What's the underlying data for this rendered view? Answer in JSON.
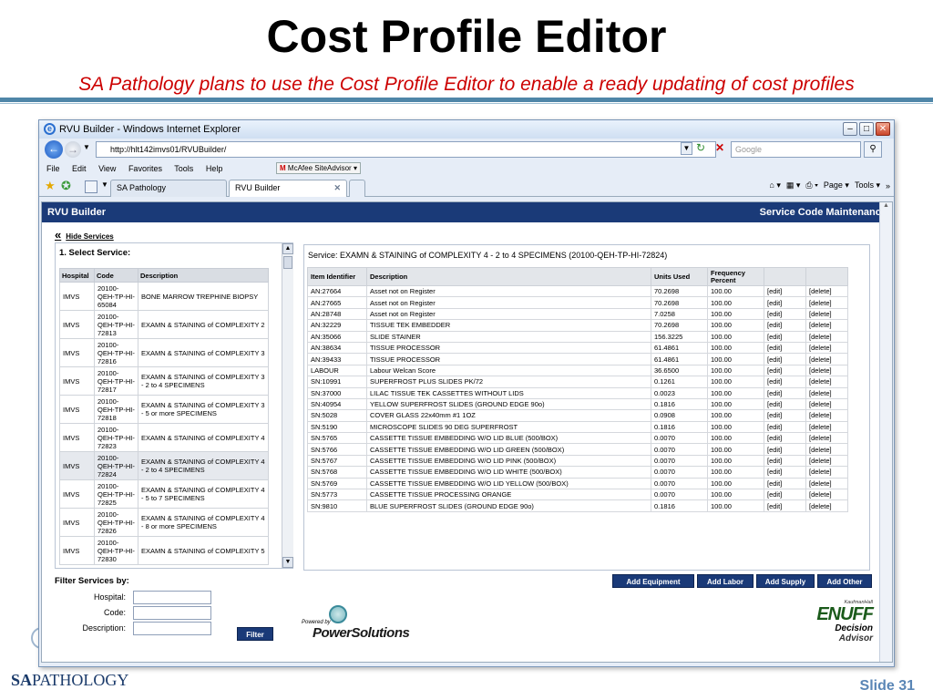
{
  "slide": {
    "title": "Cost Profile Editor",
    "subtitle": "SA Pathology plans to use the Cost Profile Editor to enable a ready updating of cost profiles",
    "footer_logo_left": "SA",
    "footer_logo_right": "PATHOLOGY",
    "slide_number": "Slide 31"
  },
  "browser": {
    "window_title": "RVU Builder - Windows Internet Explorer",
    "url": "http://hlt142imvs01/RVUBuilder/",
    "search_placeholder": "Google",
    "menu": [
      "File",
      "Edit",
      "View",
      "Favorites",
      "Tools",
      "Help"
    ],
    "mcafee": "McAfee SiteAdvisor",
    "tabs": [
      {
        "label": "SA Pathology",
        "active": false
      },
      {
        "label": "RVU Builder",
        "active": true
      }
    ],
    "toolbar_right": {
      "page": "Page",
      "tools": "Tools"
    }
  },
  "app": {
    "header_left": "RVU Builder",
    "header_right": "Service Code Maintenance",
    "hide_services": "Hide Services",
    "select_service_title": "1. Select Service:",
    "service_columns": [
      "Hospital",
      "Code",
      "Description"
    ],
    "services": [
      {
        "hospital": "IMVS",
        "code": "20100-QEH-TP-HI-65084",
        "description": "BONE MARROW TREPHINE BIOPSY",
        "selected": false
      },
      {
        "hospital": "IMVS",
        "code": "20100-QEH-TP-HI-72813",
        "description": "EXAMN & STAINING of COMPLEXITY 2",
        "selected": false
      },
      {
        "hospital": "IMVS",
        "code": "20100-QEH-TP-HI-72816",
        "description": "EXAMN & STAINING of COMPLEXITY 3",
        "selected": false
      },
      {
        "hospital": "IMVS",
        "code": "20100-QEH-TP-HI-72817",
        "description": "EXAMN & STAINING of COMPLEXITY 3 - 2 to 4 SPECIMENS",
        "selected": false
      },
      {
        "hospital": "IMVS",
        "code": "20100-QEH-TP-HI-72818",
        "description": "EXAMN & STAINING of COMPLEXITY 3 - 5 or more SPECIMENS",
        "selected": false
      },
      {
        "hospital": "IMVS",
        "code": "20100-QEH-TP-HI-72823",
        "description": "EXAMN & STAINING of COMPLEXITY 4",
        "selected": false
      },
      {
        "hospital": "IMVS",
        "code": "20100-QEH-TP-HI-72824",
        "description": "EXAMN & STAINING of COMPLEXITY 4 - 2 to 4 SPECIMENS",
        "selected": true
      },
      {
        "hospital": "IMVS",
        "code": "20100-QEH-TP-HI-72825",
        "description": "EXAMN & STAINING of COMPLEXITY 4 - 5 to 7 SPECIMENS",
        "selected": false
      },
      {
        "hospital": "IMVS",
        "code": "20100-QEH-TP-HI-72826",
        "description": "EXAMN & STAINING of COMPLEXITY 4 - 8 or more SPECIMENS",
        "selected": false
      },
      {
        "hospital": "IMVS",
        "code": "20100-QEH-TP-HI-72830",
        "description": "EXAMN & STAINING of COMPLEXITY 5",
        "selected": false
      }
    ],
    "service_title": "Service: EXAMN & STAINING of COMPLEXITY 4 - 2 to 4 SPECIMENS (20100-QEH-TP-HI-72824)",
    "item_columns": [
      "Item Identifier",
      "Description",
      "Units Used",
      "Frequency Percent",
      "",
      ""
    ],
    "items": [
      {
        "id": "AN:27664",
        "desc": "Asset not on Register",
        "units": "70.2698",
        "freq": "100.00"
      },
      {
        "id": "AN:27665",
        "desc": "Asset not on Register",
        "units": "70.2698",
        "freq": "100.00"
      },
      {
        "id": "AN:28748",
        "desc": "Asset not on Register",
        "units": "7.0258",
        "freq": "100.00"
      },
      {
        "id": "AN:32229",
        "desc": "TISSUE TEK EMBEDDER",
        "units": "70.2698",
        "freq": "100.00"
      },
      {
        "id": "AN:35066",
        "desc": "SLIDE STAINER",
        "units": "156.3225",
        "freq": "100.00"
      },
      {
        "id": "AN:38634",
        "desc": "TISSUE PROCESSOR",
        "units": "61.4861",
        "freq": "100.00"
      },
      {
        "id": "AN:39433",
        "desc": "TISSUE PROCESSOR",
        "units": "61.4861",
        "freq": "100.00"
      },
      {
        "id": "LABOUR",
        "desc": "Labour Welcan Score",
        "units": "36.6500",
        "freq": "100.00"
      },
      {
        "id": "SN:10991",
        "desc": "SUPERFROST PLUS SLIDES PK/72",
        "units": "0.1261",
        "freq": "100.00"
      },
      {
        "id": "SN:37000",
        "desc": "LILAC TISSUE TEK CASSETTES WITHOUT LIDS",
        "units": "0.0023",
        "freq": "100.00"
      },
      {
        "id": "SN:40954",
        "desc": "YELLOW SUPERFROST SLIDES (GROUND EDGE 90o)",
        "units": "0.1816",
        "freq": "100.00"
      },
      {
        "id": "SN:5028",
        "desc": "COVER GLASS 22x40mm #1 1OZ",
        "units": "0.0908",
        "freq": "100.00"
      },
      {
        "id": "SN:5190",
        "desc": "MICROSCOPE SLIDES 90 DEG SUPERFROST",
        "units": "0.1816",
        "freq": "100.00"
      },
      {
        "id": "SN:5765",
        "desc": "CASSETTE TISSUE EMBEDDING W/O LID BLUE (500/BOX)",
        "units": "0.0070",
        "freq": "100.00"
      },
      {
        "id": "SN:5766",
        "desc": "CASSETTE TISSUE EMBEDDING W/O LID GREEN (500/BOX)",
        "units": "0.0070",
        "freq": "100.00"
      },
      {
        "id": "SN:5767",
        "desc": "CASSETTE TISSUE EMBEDDING W/O LID PINK (500/BOX)",
        "units": "0.0070",
        "freq": "100.00"
      },
      {
        "id": "SN:5768",
        "desc": "CASSETTE TISSUE EMBEDDING W/O LID WHITE (500/BOX)",
        "units": "0.0070",
        "freq": "100.00"
      },
      {
        "id": "SN:5769",
        "desc": "CASSETTE TISSUE EMBEDDING W/O LID YELLOW (500/BOX)",
        "units": "0.0070",
        "freq": "100.00"
      },
      {
        "id": "SN:5773",
        "desc": "CASSETTE TISSUE PROCESSING ORANGE",
        "units": "0.0070",
        "freq": "100.00"
      },
      {
        "id": "SN:9810",
        "desc": "BLUE SUPERFROST SLIDES (GROUND EDGE 90o)",
        "units": "0.1816",
        "freq": "100.00"
      }
    ],
    "edit_label": "[edit]",
    "delete_label": "[delete]",
    "buttons": {
      "add_equipment": "Add Equipment",
      "add_labor": "Add Labor",
      "add_supply": "Add Supply",
      "add_other": "Add Other"
    },
    "filter": {
      "title": "Filter Services by:",
      "hospital_label": "Hospital:",
      "code_label": "Code:",
      "description_label": "Description:",
      "button": "Filter"
    },
    "powered_by": "Powered by",
    "powersolutions": "PowerSolutions",
    "enuff": {
      "kh": "KaufmanHall",
      "brand": "ENUFF",
      "line1": "Decision",
      "line2": "Advisor"
    }
  }
}
